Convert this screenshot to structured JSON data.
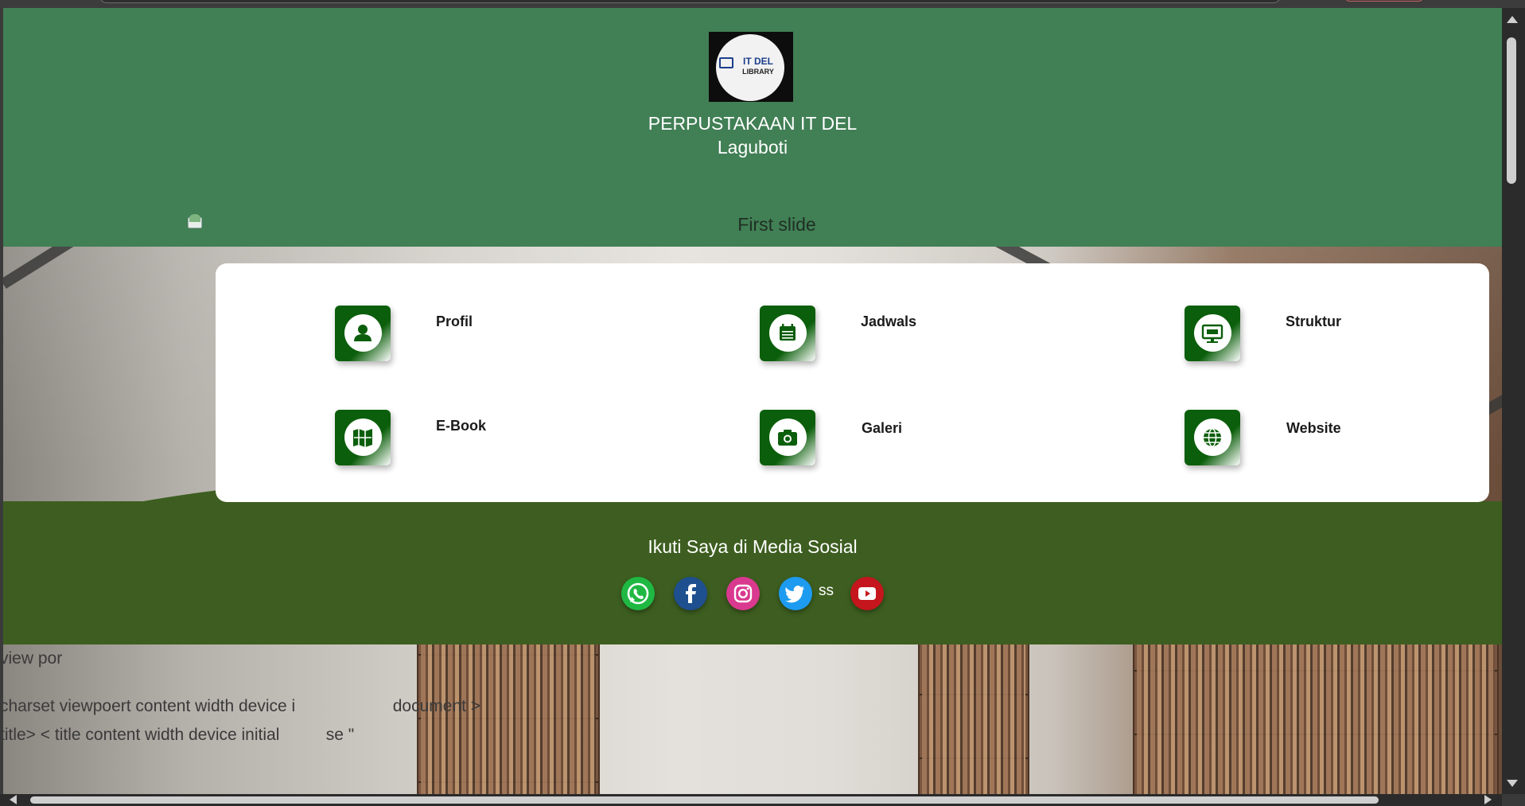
{
  "header": {
    "logo_text_line1": "IT DEL",
    "logo_text_line2": "LIBRARY",
    "title_line1": "PERPUSTAKAAN IT DEL",
    "title_line2": "Laguboti"
  },
  "carousel": {
    "caption": "First slide"
  },
  "menu": {
    "items": [
      {
        "label": "Profil",
        "icon": "user-icon"
      },
      {
        "label": "Jadwals",
        "icon": "calendar-icon"
      },
      {
        "label": "Struktur",
        "icon": "monitor-icon"
      },
      {
        "label": "E-Book",
        "icon": "map-icon"
      },
      {
        "label": "Galeri",
        "icon": "camera-icon"
      },
      {
        "label": "Website",
        "icon": "globe-icon"
      }
    ]
  },
  "social": {
    "heading": "Ikuti Saya di Media Sosial",
    "stray_text": "ss",
    "links": [
      {
        "icon": "whatsapp-icon",
        "color": "#1fb843"
      },
      {
        "icon": "facebook-icon",
        "color": "#1e4f8f"
      },
      {
        "icon": "instagram-icon",
        "color": "#d9398e"
      },
      {
        "icon": "twitter-icon",
        "color": "#1d9bf0"
      },
      {
        "icon": "youtube-icon",
        "color": "#c4161c"
      }
    ]
  },
  "raw_text": {
    "line1": "view por",
    "line2": "charset viewpoert content width device i",
    "line2b": "document >",
    "line3": "title>  < title content width device initial",
    "line3b": "se \""
  },
  "colors": {
    "header_bg": "#417f55",
    "footer_bg": "#3d5e20",
    "tile_green": "#0b5e0b"
  }
}
